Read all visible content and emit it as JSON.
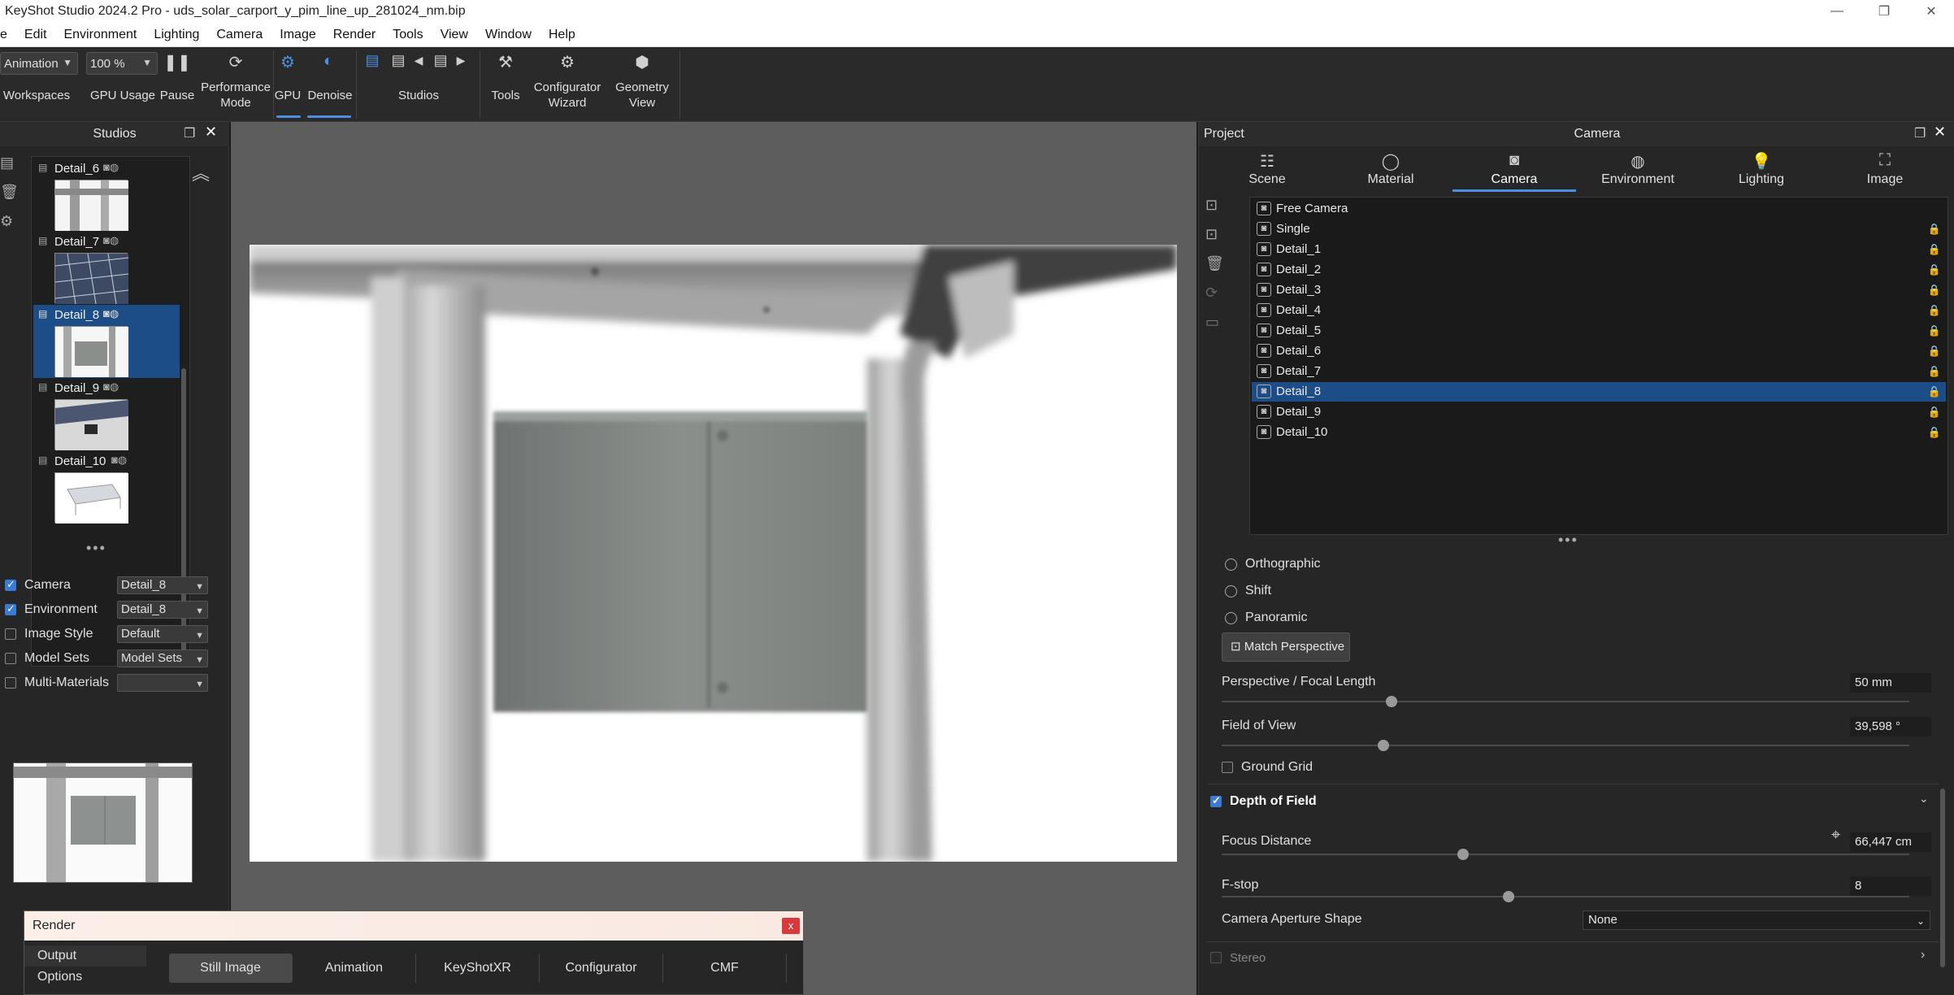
{
  "window": {
    "title": "KeyShot Studio 2024.2 Pro  - uds_solar_carport_y_pim_line_up_281024_nm.bip"
  },
  "menu": {
    "items": [
      "e",
      "Edit",
      "Environment",
      "Lighting",
      "Camera",
      "Image",
      "Render",
      "Tools",
      "View",
      "Window",
      "Help"
    ]
  },
  "toolbar": {
    "workspace_select": "Animation",
    "workspace_label": "Workspaces",
    "gpu_usage_select": "100 %",
    "gpu_usage_label": "GPU Usage",
    "pause_label": "Pause",
    "performance_label_1": "Performance",
    "performance_label_2": "Mode",
    "gpu_label": "GPU",
    "denoise_label": "Denoise",
    "studios_label": "Studios",
    "tools_label": "Tools",
    "configurator_label_1": "Configurator",
    "configurator_label_2": "Wizard",
    "geometry_label_1": "Geometry",
    "geometry_label_2": "View",
    "accent_color": "#4a8fe0"
  },
  "studios_panel": {
    "title": "Studios",
    "items": [
      {
        "name": "Detail_6",
        "selected": false
      },
      {
        "name": "Detail_7",
        "selected": false
      },
      {
        "name": "Detail_8",
        "selected": true
      },
      {
        "name": "Detail_9",
        "selected": false
      },
      {
        "name": "Detail_10",
        "selected": false
      }
    ],
    "options": [
      {
        "label": "Camera",
        "checked": true,
        "value": "Detail_8"
      },
      {
        "label": "Environment",
        "checked": true,
        "value": "Detail_8"
      },
      {
        "label": "Image Style",
        "checked": false,
        "value": "Default"
      },
      {
        "label": "Model Sets",
        "checked": false,
        "value": "Model Sets"
      },
      {
        "label": "Multi-Materials",
        "checked": false,
        "value": ""
      }
    ]
  },
  "render_dialog": {
    "title": "Render",
    "close": "x",
    "side": [
      "Output",
      "Options"
    ],
    "tabs": [
      "Still Image",
      "Animation",
      "KeyShotXR",
      "Configurator",
      "CMF"
    ],
    "active_tab": "Still Image"
  },
  "project_panel": {
    "title": "Project",
    "section": "Camera",
    "tabs": [
      {
        "label": "Scene",
        "icon": "scene-icon"
      },
      {
        "label": "Material",
        "icon": "material-icon"
      },
      {
        "label": "Camera",
        "icon": "camera-icon"
      },
      {
        "label": "Environment",
        "icon": "environment-icon"
      },
      {
        "label": "Lighting",
        "icon": "lighting-icon"
      },
      {
        "label": "Image",
        "icon": "image-icon"
      }
    ],
    "active_tab": "Camera",
    "cameras": [
      {
        "name": "Free Camera",
        "locked": false,
        "selected": false
      },
      {
        "name": "Single",
        "locked": true,
        "selected": false
      },
      {
        "name": "Detail_1",
        "locked": true,
        "selected": false
      },
      {
        "name": "Detail_2",
        "locked": true,
        "selected": false
      },
      {
        "name": "Detail_3",
        "locked": true,
        "selected": false
      },
      {
        "name": "Detail_4",
        "locked": true,
        "selected": false
      },
      {
        "name": "Detail_5",
        "locked": true,
        "selected": false
      },
      {
        "name": "Detail_6",
        "locked": true,
        "selected": false
      },
      {
        "name": "Detail_7",
        "locked": true,
        "selected": false
      },
      {
        "name": "Detail_8",
        "locked": true,
        "selected": true
      },
      {
        "name": "Detail_9",
        "locked": true,
        "selected": false
      },
      {
        "name": "Detail_10",
        "locked": true,
        "selected": false
      }
    ],
    "projection": [
      "Orthographic",
      "Shift",
      "Panoramic"
    ],
    "match_perspective": "Match Perspective",
    "focal_length_label": "Perspective / Focal Length",
    "focal_length_value": "50 mm",
    "fov_label": "Field of View",
    "fov_value": "39,598 °",
    "ground_grid_label": "Ground Grid",
    "dof_label": "Depth of Field",
    "dof_checked": true,
    "focus_distance_label": "Focus Distance",
    "focus_distance_value": "66,447 cm",
    "fstop_label": "F-stop",
    "fstop_value": "8",
    "aperture_label": "Camera Aperture Shape",
    "aperture_value": "None",
    "stereo_label": "Stereo"
  }
}
